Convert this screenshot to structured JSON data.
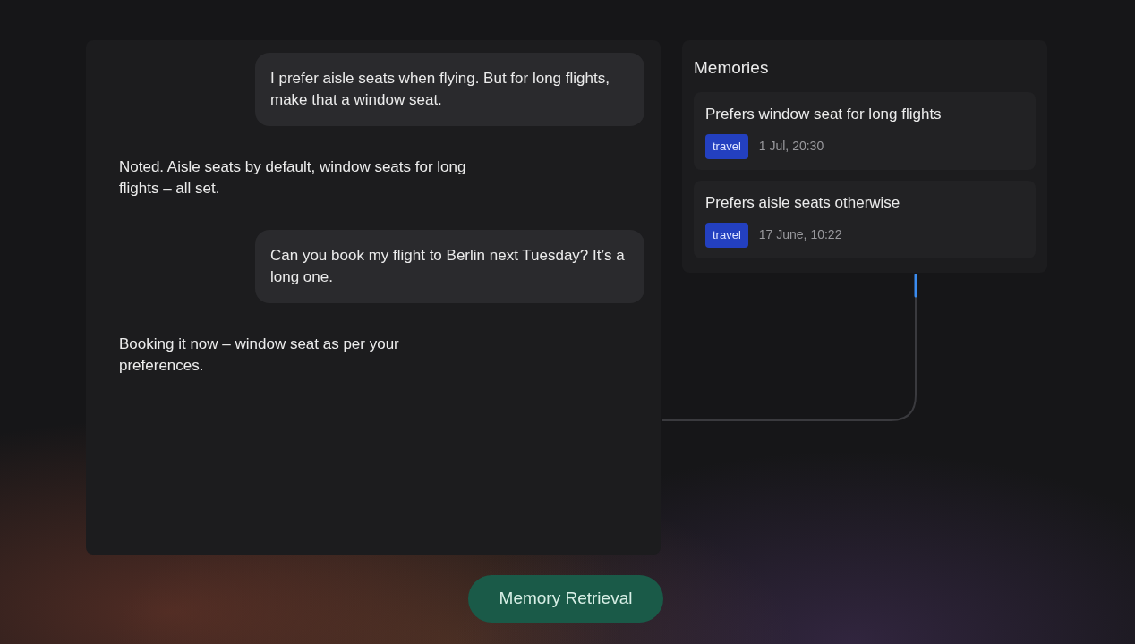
{
  "messages": [
    {
      "kind": "user",
      "text": "I prefer aisle seats when flying. But for long flights, make that a window seat."
    },
    {
      "kind": "assistant",
      "text": "Noted. Aisle seats by default, window seats for long flights – all set."
    },
    {
      "kind": "user",
      "text": "Can you book my flight to Berlin next Tuesday? It’s a long one."
    },
    {
      "kind": "assistant",
      "text": "Booking it now – window seat as per your preferences."
    }
  ],
  "memories": {
    "title": "Memories",
    "items": [
      {
        "text": "Prefers window seat for long flights",
        "tag": "travel",
        "time": "1 Jul, 20:30"
      },
      {
        "text": "Prefers aisle seats otherwise",
        "tag": "travel",
        "time": "17 June, 10:22"
      }
    ]
  },
  "action_button": "Memory Retrieval"
}
